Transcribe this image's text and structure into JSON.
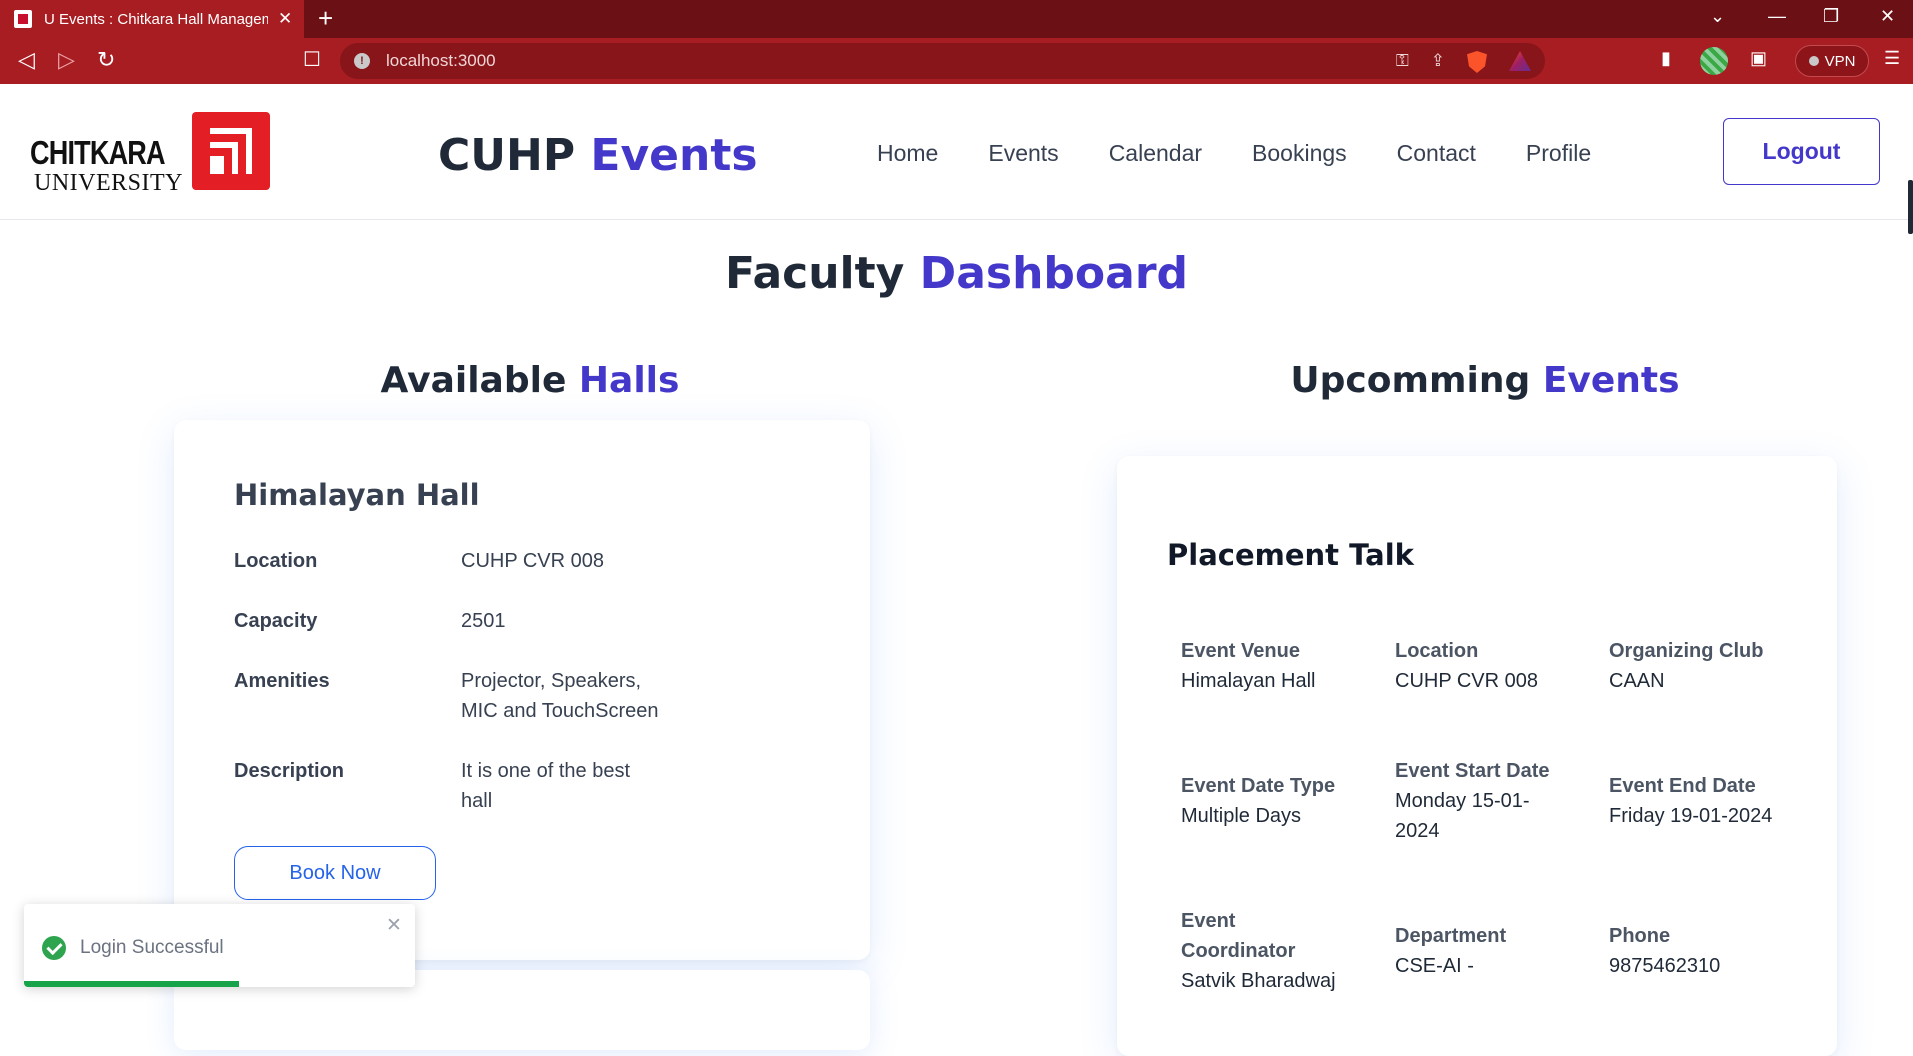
{
  "browser": {
    "tab_title": "U Events : Chitkara Hall Managem",
    "url": "localhost:3000",
    "vpn_label": "VPN"
  },
  "header": {
    "logo_line1": "CHITKARA",
    "logo_line2": "UNIVERSITY",
    "brand_primary": "CUHP",
    "brand_accent": "Events",
    "nav": [
      "Home",
      "Events",
      "Calendar",
      "Bookings",
      "Contact",
      "Profile"
    ],
    "logout_label": "Logout"
  },
  "page": {
    "title_primary": "Faculty",
    "title_accent": "Dashboard"
  },
  "halls_section": {
    "title_primary": "Available",
    "title_accent": "Halls",
    "hall": {
      "name": "Himalayan Hall",
      "location_label": "Location",
      "location": "CUHP CVR 008",
      "capacity_label": "Capacity",
      "capacity": "2501",
      "amenities_label": "Amenities",
      "amenities": "Projector, Speakers, MIC and TouchScreen",
      "description_label": "Description",
      "description": "It is one of the best hall",
      "book_label": "Book Now"
    }
  },
  "events_section": {
    "title_primary": "Upcomming",
    "title_accent": "Events",
    "event": {
      "title": "Placement Talk",
      "venue_label": "Event Venue",
      "venue": "Himalayan Hall",
      "location_label": "Location",
      "location": "CUHP CVR 008",
      "club_label": "Organizing Club",
      "club": "CAAN",
      "date_type_label": "Event Date Type",
      "date_type": "Multiple Days",
      "start_label": "Event Start Date",
      "start": "Monday 15-01-2024",
      "end_label": "Event End Date",
      "end": "Friday 19-01-2024",
      "coordinator_label": "Event Coordinator",
      "coordinator": "Satvik Bharadwaj",
      "department_label": "Department",
      "department": "CSE-AI -",
      "phone_label": "Phone",
      "phone": "9875462310"
    }
  },
  "toast": {
    "message": "Login Successful",
    "progress_fraction": 0.55
  },
  "colors": {
    "accent": "#4338ca",
    "browser_red": "#a81d22",
    "success": "#16a34a"
  }
}
